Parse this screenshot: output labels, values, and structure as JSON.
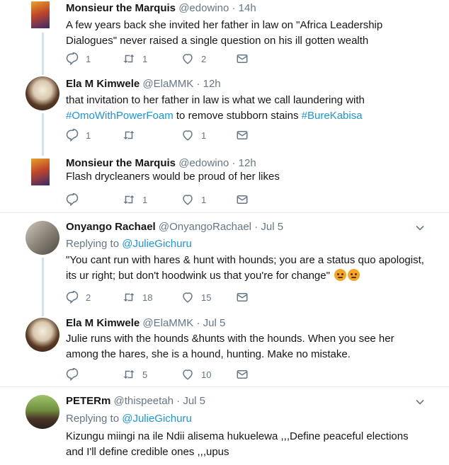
{
  "tweets": [
    {
      "name": "Monsieur the Marquis",
      "handle": "@edowino",
      "time": "14h",
      "text": "A few years back she invited her father in law on \"Africa Leadership Dialogues\" never raised a single question on his ill gotten wealth",
      "replies": "1",
      "retweets": "1",
      "likes": "2"
    },
    {
      "name": "Ela M Kimwele",
      "handle": "@ElaMMK",
      "time": "12h",
      "text_before": "that invitation to her father in law is what we call laundering with",
      "hashtag1": "#OmoWithPowerFoam",
      "text_mid": "to remove stubborn stains",
      "hashtag2": "#BureKabisa",
      "replies": "1",
      "retweets": "",
      "likes": "1"
    },
    {
      "name": "Monsieur the Marquis",
      "handle": "@edowino",
      "time": "12h",
      "text": "Flash drycleaners would be proud of her likes",
      "replies": "",
      "retweets": "1",
      "likes": "1"
    },
    {
      "name": "Onyango Rachael",
      "handle": "@OnyangoRachael",
      "time": "Jul 5",
      "replying_label": "Replying to",
      "replying_to": "@JulieGichuru",
      "text": "\"You cant run with hares & hunt with hounds; you are a status quo apologist, its ur right; but don't hoodwink us that you're for change\"",
      "replies": "2",
      "retweets": "18",
      "likes": "15"
    },
    {
      "name": "Ela M Kimwele",
      "handle": "@ElaMMK",
      "time": "Jul 5",
      "text": "Julie runs with the hounds &hunts with the hounds. When you see her among the hares, she is a hound, hunting. Make no mistake.",
      "replies": "",
      "retweets": "5",
      "likes": "10"
    },
    {
      "name": "PETERm",
      "handle": "@thispeetah",
      "time": "Jul 5",
      "replying_label": "Replying to",
      "replying_to": "@JulieGichuru",
      "text": "Kizungu miingi na ile Ndii alisema hukuelewa ,,,Define peaceful elections and I'll define credible ones ,,,upus"
    }
  ],
  "separator": "·",
  "icons": [
    "reply-icon",
    "retweet-icon",
    "like-icon",
    "dm-icon",
    "chevron-down-icon",
    "angry-face-icon"
  ],
  "colors": {
    "link": "#1b95e0",
    "muted": "#657786",
    "thread_line": "#cce4f7",
    "divider": "#e6ecf0"
  }
}
